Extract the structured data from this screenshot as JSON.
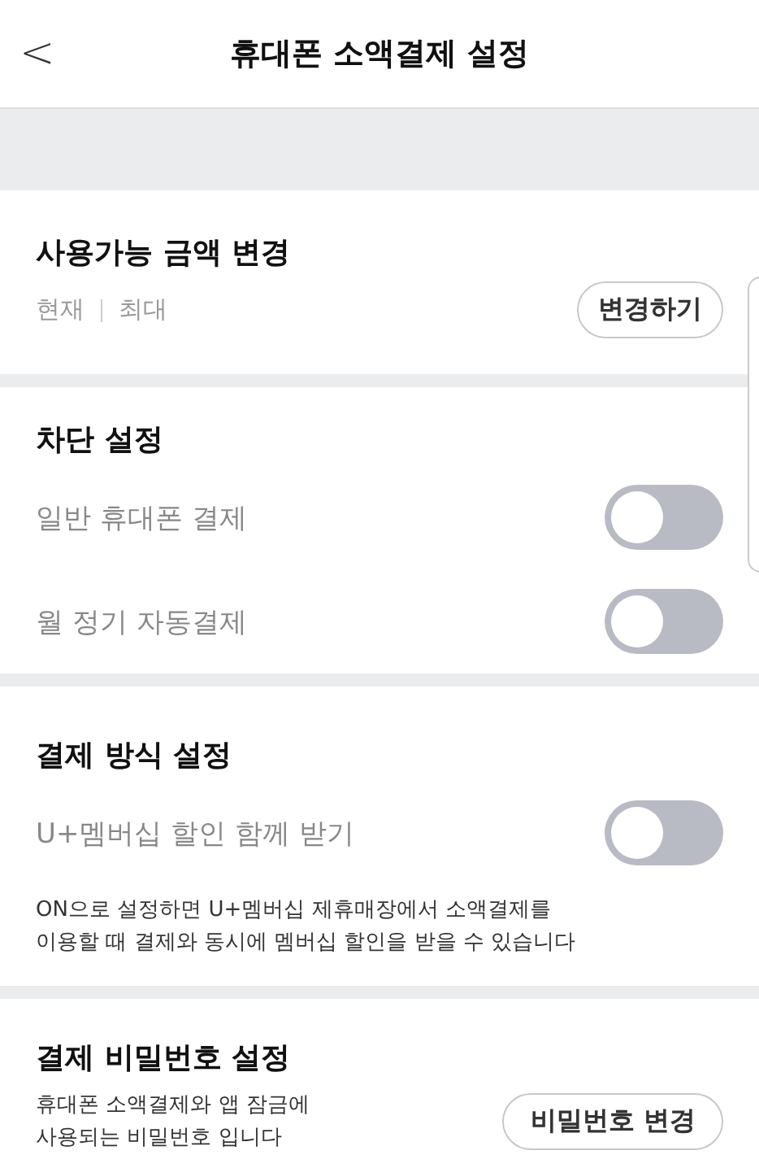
{
  "header": {
    "back": "<",
    "title": "휴대폰 소액결제 설정"
  },
  "sections": [
    {
      "title": "사용가능 금액 변경",
      "rows": [
        {
          "kind": "amount",
          "labels": [
            "현재",
            "최대"
          ],
          "button": "변경하기"
        }
      ]
    },
    {
      "title": "차단 설정",
      "rows": [
        {
          "kind": "toggle",
          "label": "일반 휴대폰 결제",
          "on": false
        },
        {
          "kind": "toggle",
          "label": "월 정기 자동결제",
          "on": false
        }
      ]
    },
    {
      "title": "결제 방식 설정",
      "rows": [
        {
          "kind": "toggle",
          "label": "U+멤버십 할인 함께 받기",
          "on": false
        },
        {
          "kind": "note",
          "text": "ON으로 설정하면 U+멤버십 제휴매장에서 소액결제를\n이용할 때 결제와 동시에 멤버십 할인을 받을 수 있습니다"
        }
      ]
    },
    {
      "title": "결제 비밀번호 설정",
      "rows": [
        {
          "kind": "action",
          "text": "휴대폰 소액결제와 앱 잠금에\n사용되는 비밀번호 입니다",
          "button": "비밀번호 변경"
        }
      ]
    }
  ]
}
